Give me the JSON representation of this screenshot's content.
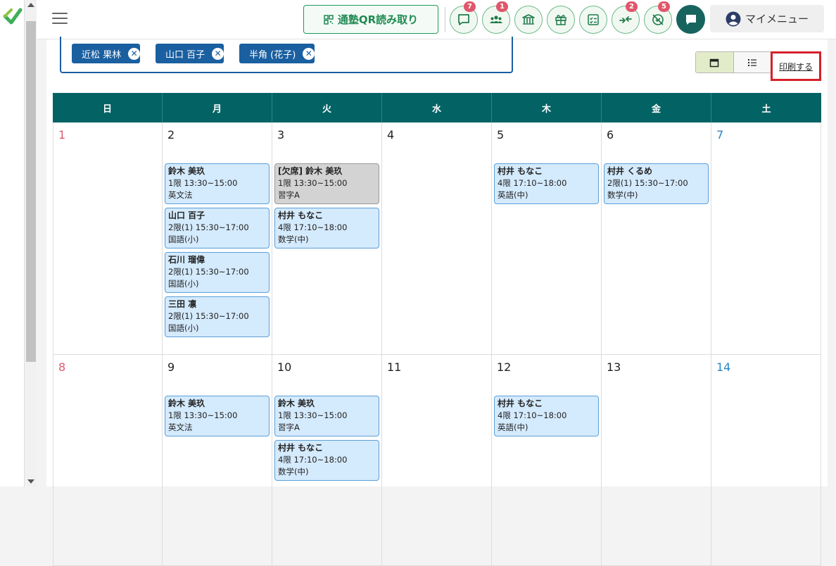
{
  "header": {
    "qr_label": "通塾QR読み取り",
    "badges": {
      "messages": "7",
      "students": "1",
      "transfer": "2",
      "alerts": "5"
    },
    "my_menu_label": "マイメニュー"
  },
  "filters": {
    "tags": [
      {
        "label": "近松 果林"
      },
      {
        "label": "山口 百子"
      },
      {
        "label": "半角 (花子)"
      }
    ]
  },
  "print_label": "印刷する",
  "weekdays": [
    "日",
    "月",
    "火",
    "水",
    "木",
    "金",
    "土"
  ],
  "week1": {
    "days": [
      "1",
      "2",
      "3",
      "4",
      "5",
      "6",
      "7"
    ],
    "mon": [
      {
        "name": "鈴木 美玖",
        "time": "1限 13:30~15:00",
        "subject": "英文法"
      },
      {
        "name": "山口 百子",
        "time": "2限(1) 15:30~17:00",
        "subject": "国語(小)"
      },
      {
        "name": "石川 瑠偉",
        "time": "2限(1) 15:30~17:00",
        "subject": "国語(小)"
      },
      {
        "name": "三田 凛",
        "time": "2限(1) 15:30~17:00",
        "subject": "国語(小)"
      }
    ],
    "tue": [
      {
        "name": "[欠席] 鈴木 美玖",
        "time": "1限 13:30~15:00",
        "subject": "習字A"
      },
      {
        "name": "村井 もなこ",
        "time": "4限 17:10~18:00",
        "subject": "数学(中)"
      }
    ],
    "thu": [
      {
        "name": "村井 もなこ",
        "time": "4限 17:10~18:00",
        "subject": "英語(中)"
      }
    ],
    "fri": [
      {
        "name": "村井 くるめ",
        "time": "2限(1) 15:30~17:00",
        "subject": "数学(中)"
      }
    ]
  },
  "week2": {
    "days": [
      "8",
      "9",
      "10",
      "11",
      "12",
      "13",
      "14"
    ],
    "mon": [
      {
        "name": "鈴木 美玖",
        "time": "1限 13:30~15:00",
        "subject": "英文法"
      }
    ],
    "tue": [
      {
        "name": "鈴木 美玖",
        "time": "1限 13:30~15:00",
        "subject": "習字A"
      },
      {
        "name": "村井 もなこ",
        "time": "4限 17:10~18:00",
        "subject": "数学(中)"
      }
    ],
    "thu": [
      {
        "name": "村井 もなこ",
        "time": "4限 17:10~18:00",
        "subject": "英語(中)"
      }
    ]
  },
  "colors": {
    "header_teal": "#036364",
    "brand_green": "#1f8a52",
    "tag_blue": "#1a5fa0",
    "event_bg": "#d4eafd",
    "absent_bg": "#d3d3d3",
    "sunday": "#d95a6e",
    "saturday": "#2a86c4",
    "badge_red": "#e0566b",
    "print_highlight": "#d6202a"
  },
  "icons": {
    "logo": "app-logo",
    "hamburger": "hamburger-icon",
    "qr": "qr-icon",
    "message": "message-icon",
    "students": "students-icon",
    "school": "school-icon",
    "gift": "gift-icon",
    "checklist": "checklist-icon",
    "transfer": "transfer-icon",
    "alert": "alert-off-icon",
    "chat": "chat-icon",
    "account": "account-icon",
    "calendar_view": "calendar-icon",
    "list_view": "list-icon"
  }
}
